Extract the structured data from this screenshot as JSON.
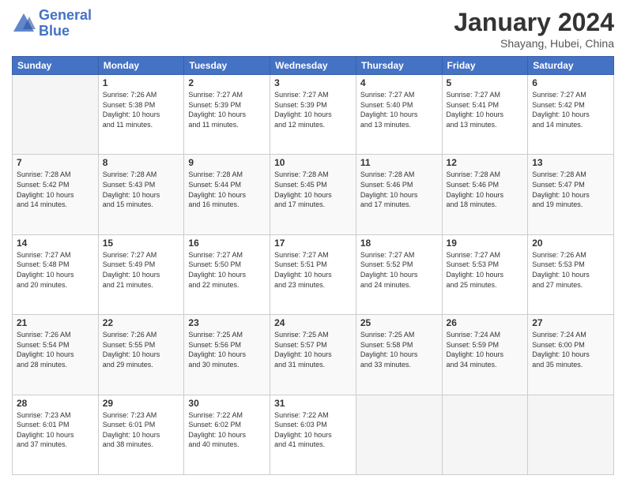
{
  "header": {
    "logo_line1": "General",
    "logo_line2": "Blue",
    "month": "January 2024",
    "location": "Shayang, Hubei, China"
  },
  "weekdays": [
    "Sunday",
    "Monday",
    "Tuesday",
    "Wednesday",
    "Thursday",
    "Friday",
    "Saturday"
  ],
  "weeks": [
    [
      {
        "num": "",
        "info": ""
      },
      {
        "num": "1",
        "info": "Sunrise: 7:26 AM\nSunset: 5:38 PM\nDaylight: 10 hours\nand 11 minutes."
      },
      {
        "num": "2",
        "info": "Sunrise: 7:27 AM\nSunset: 5:39 PM\nDaylight: 10 hours\nand 11 minutes."
      },
      {
        "num": "3",
        "info": "Sunrise: 7:27 AM\nSunset: 5:39 PM\nDaylight: 10 hours\nand 12 minutes."
      },
      {
        "num": "4",
        "info": "Sunrise: 7:27 AM\nSunset: 5:40 PM\nDaylight: 10 hours\nand 13 minutes."
      },
      {
        "num": "5",
        "info": "Sunrise: 7:27 AM\nSunset: 5:41 PM\nDaylight: 10 hours\nand 13 minutes."
      },
      {
        "num": "6",
        "info": "Sunrise: 7:27 AM\nSunset: 5:42 PM\nDaylight: 10 hours\nand 14 minutes."
      }
    ],
    [
      {
        "num": "7",
        "info": "Sunrise: 7:28 AM\nSunset: 5:42 PM\nDaylight: 10 hours\nand 14 minutes."
      },
      {
        "num": "8",
        "info": "Sunrise: 7:28 AM\nSunset: 5:43 PM\nDaylight: 10 hours\nand 15 minutes."
      },
      {
        "num": "9",
        "info": "Sunrise: 7:28 AM\nSunset: 5:44 PM\nDaylight: 10 hours\nand 16 minutes."
      },
      {
        "num": "10",
        "info": "Sunrise: 7:28 AM\nSunset: 5:45 PM\nDaylight: 10 hours\nand 17 minutes."
      },
      {
        "num": "11",
        "info": "Sunrise: 7:28 AM\nSunset: 5:46 PM\nDaylight: 10 hours\nand 17 minutes."
      },
      {
        "num": "12",
        "info": "Sunrise: 7:28 AM\nSunset: 5:46 PM\nDaylight: 10 hours\nand 18 minutes."
      },
      {
        "num": "13",
        "info": "Sunrise: 7:28 AM\nSunset: 5:47 PM\nDaylight: 10 hours\nand 19 minutes."
      }
    ],
    [
      {
        "num": "14",
        "info": "Sunrise: 7:27 AM\nSunset: 5:48 PM\nDaylight: 10 hours\nand 20 minutes."
      },
      {
        "num": "15",
        "info": "Sunrise: 7:27 AM\nSunset: 5:49 PM\nDaylight: 10 hours\nand 21 minutes."
      },
      {
        "num": "16",
        "info": "Sunrise: 7:27 AM\nSunset: 5:50 PM\nDaylight: 10 hours\nand 22 minutes."
      },
      {
        "num": "17",
        "info": "Sunrise: 7:27 AM\nSunset: 5:51 PM\nDaylight: 10 hours\nand 23 minutes."
      },
      {
        "num": "18",
        "info": "Sunrise: 7:27 AM\nSunset: 5:52 PM\nDaylight: 10 hours\nand 24 minutes."
      },
      {
        "num": "19",
        "info": "Sunrise: 7:27 AM\nSunset: 5:53 PM\nDaylight: 10 hours\nand 25 minutes."
      },
      {
        "num": "20",
        "info": "Sunrise: 7:26 AM\nSunset: 5:53 PM\nDaylight: 10 hours\nand 27 minutes."
      }
    ],
    [
      {
        "num": "21",
        "info": "Sunrise: 7:26 AM\nSunset: 5:54 PM\nDaylight: 10 hours\nand 28 minutes."
      },
      {
        "num": "22",
        "info": "Sunrise: 7:26 AM\nSunset: 5:55 PM\nDaylight: 10 hours\nand 29 minutes."
      },
      {
        "num": "23",
        "info": "Sunrise: 7:25 AM\nSunset: 5:56 PM\nDaylight: 10 hours\nand 30 minutes."
      },
      {
        "num": "24",
        "info": "Sunrise: 7:25 AM\nSunset: 5:57 PM\nDaylight: 10 hours\nand 31 minutes."
      },
      {
        "num": "25",
        "info": "Sunrise: 7:25 AM\nSunset: 5:58 PM\nDaylight: 10 hours\nand 33 minutes."
      },
      {
        "num": "26",
        "info": "Sunrise: 7:24 AM\nSunset: 5:59 PM\nDaylight: 10 hours\nand 34 minutes."
      },
      {
        "num": "27",
        "info": "Sunrise: 7:24 AM\nSunset: 6:00 PM\nDaylight: 10 hours\nand 35 minutes."
      }
    ],
    [
      {
        "num": "28",
        "info": "Sunrise: 7:23 AM\nSunset: 6:01 PM\nDaylight: 10 hours\nand 37 minutes."
      },
      {
        "num": "29",
        "info": "Sunrise: 7:23 AM\nSunset: 6:01 PM\nDaylight: 10 hours\nand 38 minutes."
      },
      {
        "num": "30",
        "info": "Sunrise: 7:22 AM\nSunset: 6:02 PM\nDaylight: 10 hours\nand 40 minutes."
      },
      {
        "num": "31",
        "info": "Sunrise: 7:22 AM\nSunset: 6:03 PM\nDaylight: 10 hours\nand 41 minutes."
      },
      {
        "num": "",
        "info": ""
      },
      {
        "num": "",
        "info": ""
      },
      {
        "num": "",
        "info": ""
      }
    ]
  ]
}
